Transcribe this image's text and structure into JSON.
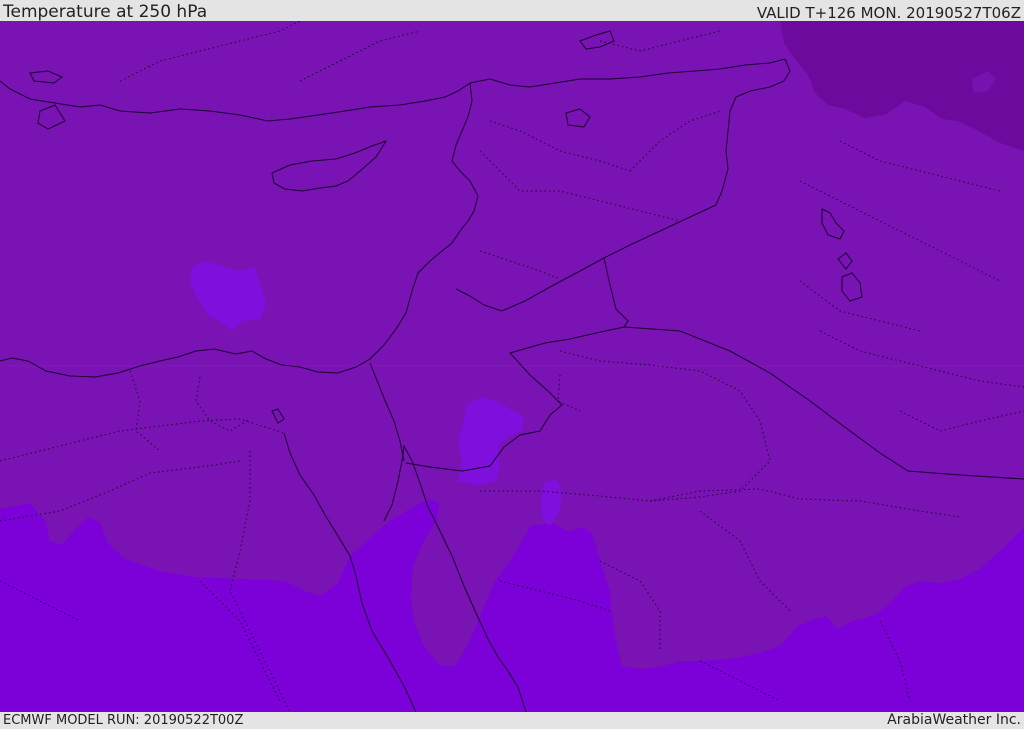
{
  "header": {
    "title": "Temperature at 250 hPa",
    "valid": "VALID T+126 MON. 20190527T06Z"
  },
  "footer": {
    "model_run": "ECMWF MODEL RUN: 20190522T00Z",
    "credit": "ArabiaWeather Inc."
  },
  "map": {
    "colors": {
      "base_field": "#7a13b3",
      "cold_patch": "#6c0a9d",
      "warm_field": "#7c00d8",
      "warm_patch": "#7e0fdc",
      "coastline": "#1a0030",
      "border": "#1a0030"
    }
  }
}
